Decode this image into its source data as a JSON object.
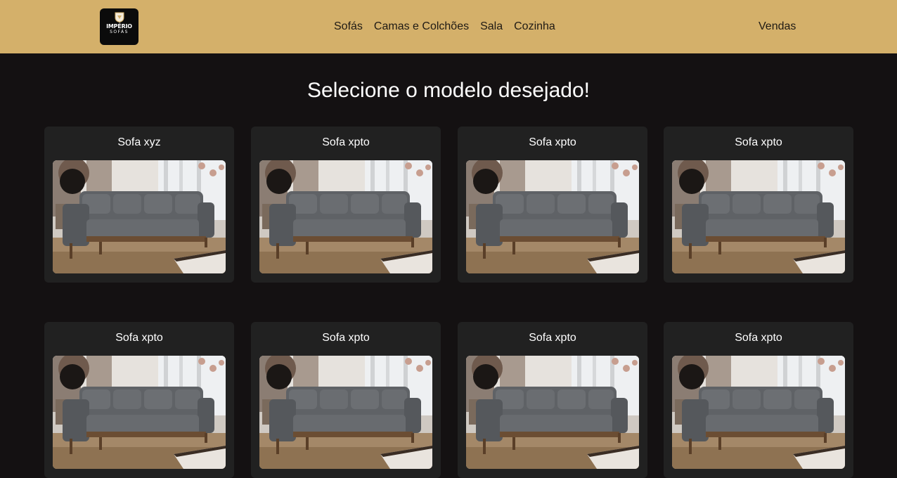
{
  "brand": {
    "line1": "IMPÉRIO",
    "line2": "SOFÁS"
  },
  "nav": {
    "items": [
      "Sofás",
      "Camas e Colchões",
      "Sala",
      "Cozinha"
    ],
    "right": "Vendas"
  },
  "page": {
    "title": "Selecione o modelo desejado!"
  },
  "products": [
    {
      "name": "Sofa xyz",
      "image": "gray-tufted-sofa-photo"
    },
    {
      "name": "Sofa xpto",
      "image": "gray-tufted-sofa-photo"
    },
    {
      "name": "Sofa xpto",
      "image": "gray-tufted-sofa-photo"
    },
    {
      "name": "Sofa xpto",
      "image": "gray-tufted-sofa-photo"
    },
    {
      "name": "Sofa xpto",
      "image": "gray-tufted-sofa-photo"
    },
    {
      "name": "Sofa xpto",
      "image": "gray-tufted-sofa-photo"
    },
    {
      "name": "Sofa xpto",
      "image": "gray-tufted-sofa-photo"
    },
    {
      "name": "Sofa xpto",
      "image": "gray-tufted-sofa-photo"
    }
  ],
  "colors": {
    "header": "#d4b06a",
    "background": "#141112",
    "card": "#212121"
  }
}
